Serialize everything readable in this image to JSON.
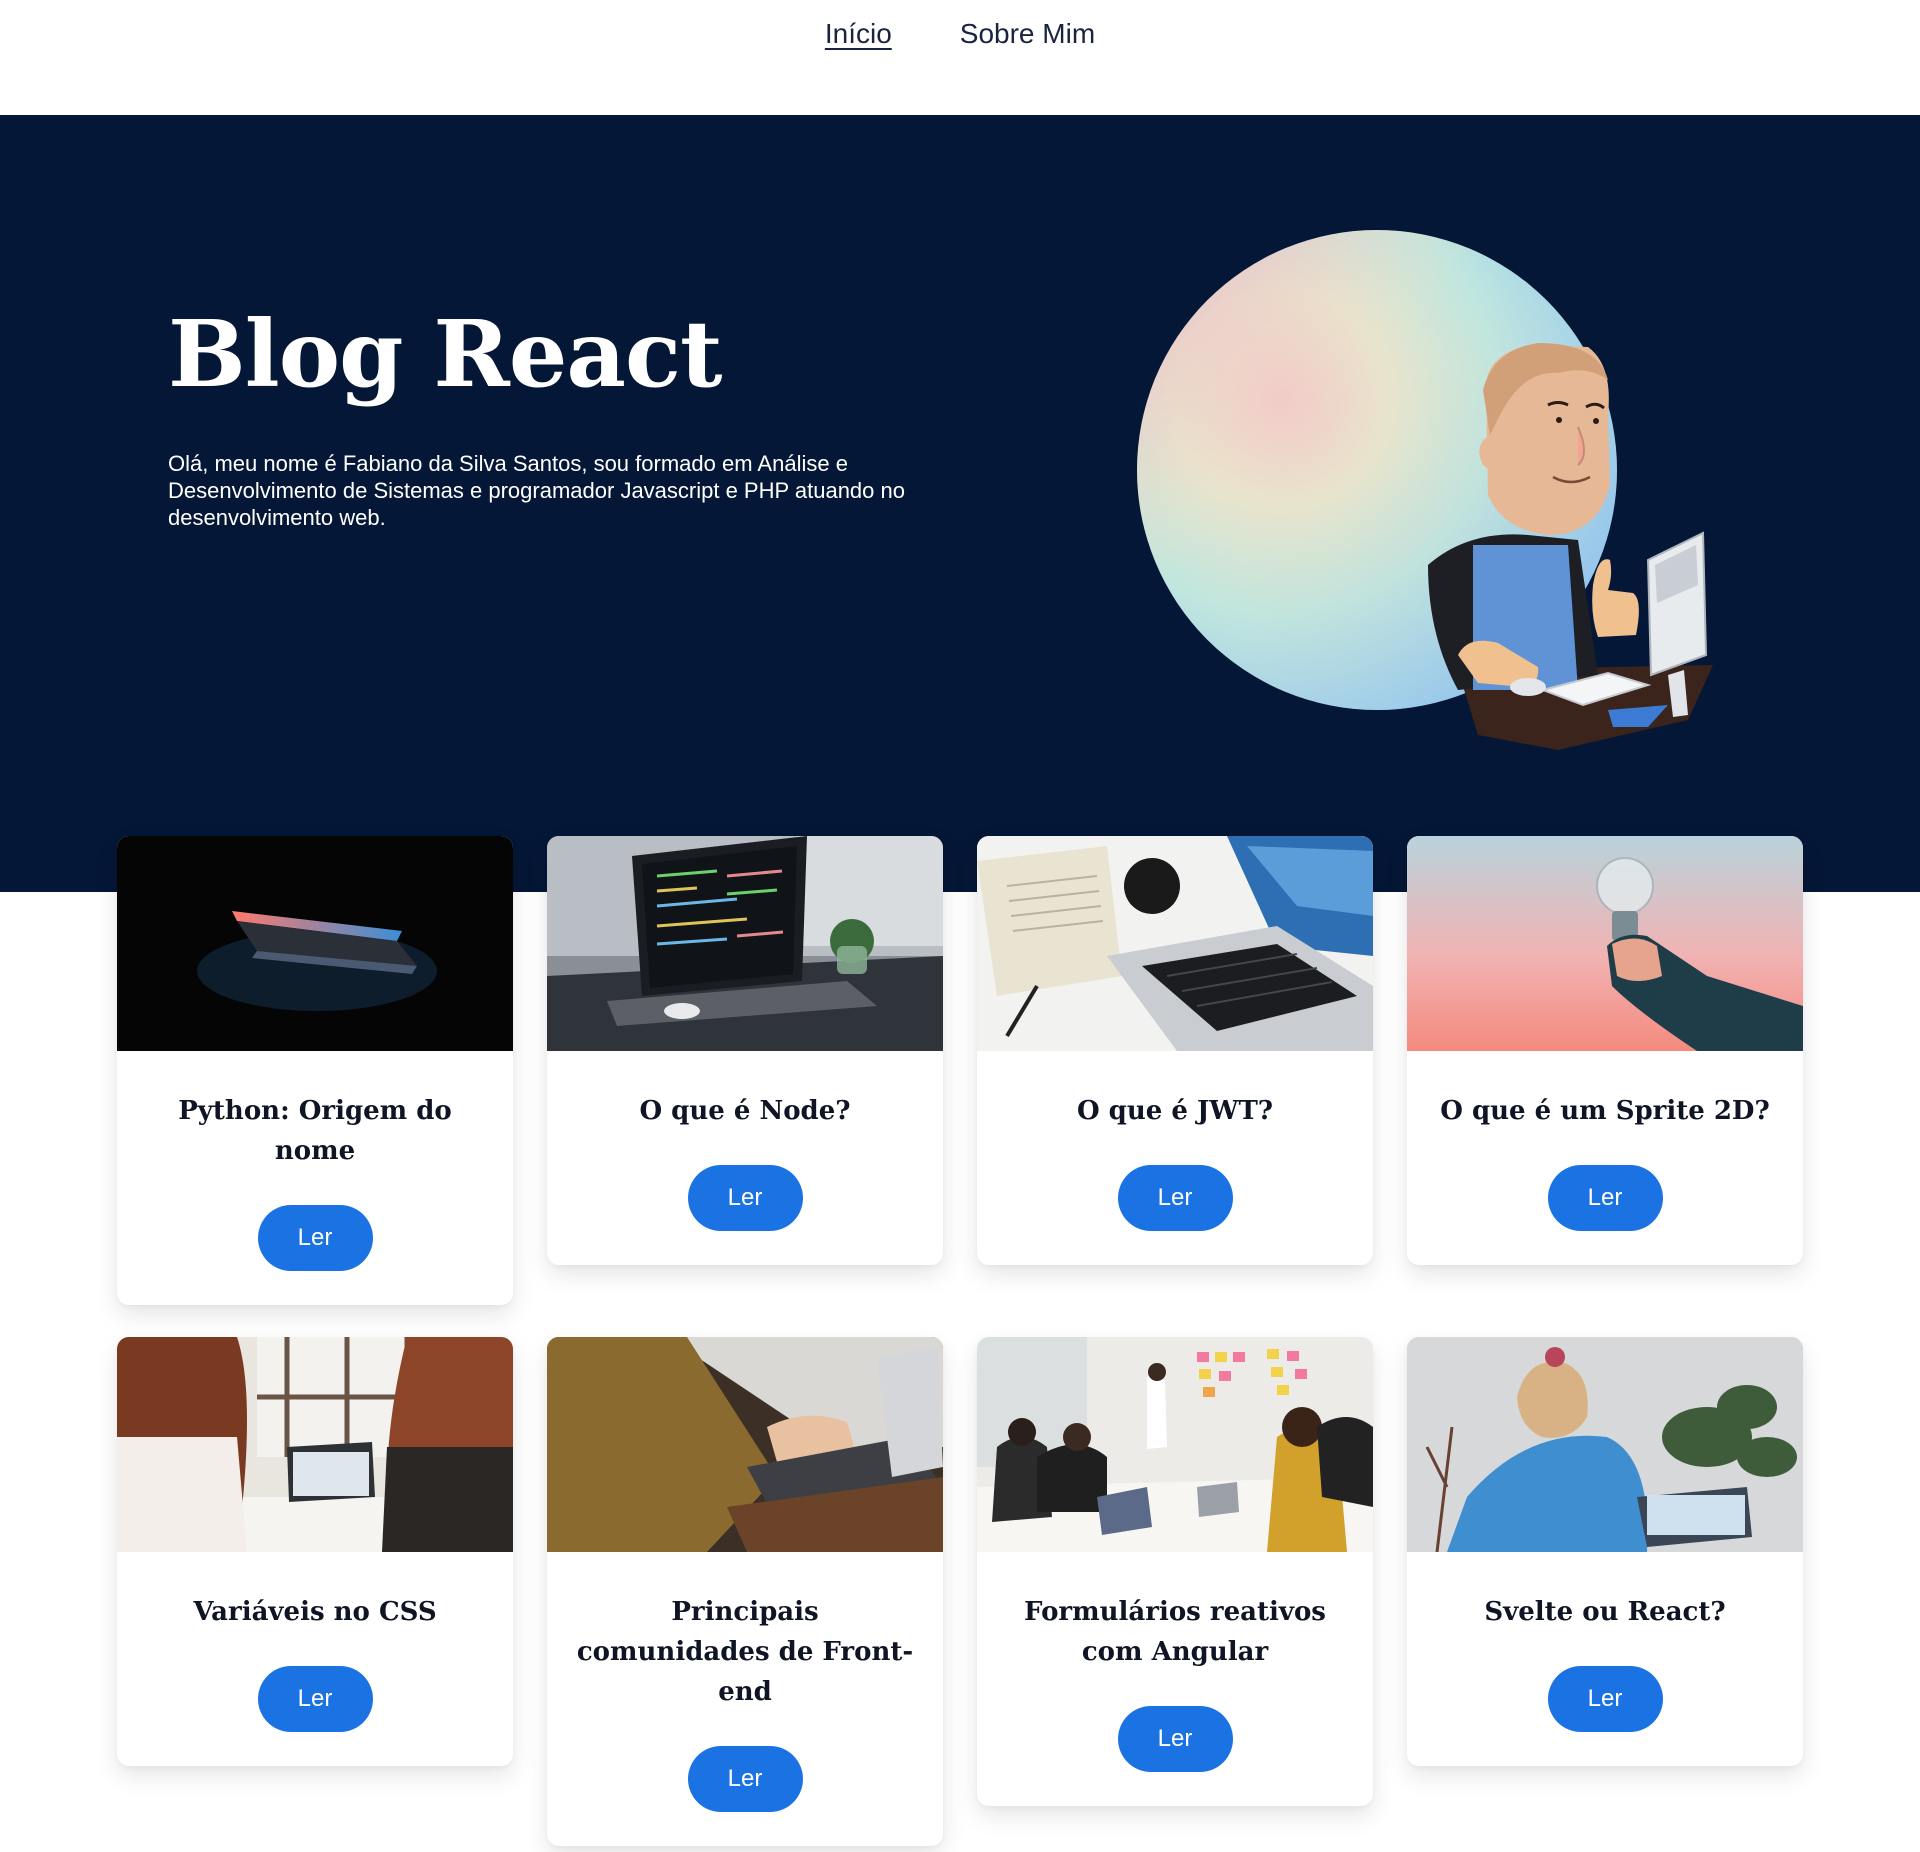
{
  "nav": {
    "items": [
      {
        "label": "Início",
        "active": true
      },
      {
        "label": "Sobre Mim",
        "active": false
      }
    ]
  },
  "hero": {
    "title": "Blog React",
    "description": "Olá, meu nome é Fabiano da Silva Santos, sou formado em Análise e Desenvolvimento de Sistemas e programador Javascript e PHP atuando no desenvolvimento web.",
    "background": "#051736"
  },
  "posts": [
    {
      "title": "Python: Origem do nome",
      "button": "Ler"
    },
    {
      "title": "O que é Node?",
      "button": "Ler"
    },
    {
      "title": "O que é JWT?",
      "button": "Ler"
    },
    {
      "title": "O que é um Sprite 2D?",
      "button": "Ler"
    },
    {
      "title": "Variáveis no CSS",
      "button": "Ler"
    },
    {
      "title": "Principais comunidades de Front-end",
      "button": "Ler"
    },
    {
      "title": "Formulários reativos com Angular",
      "button": "Ler"
    },
    {
      "title": "Svelte ou React?",
      "button": "Ler"
    }
  ],
  "colors": {
    "accent": "#1b73e3",
    "hero_bg": "#051736"
  }
}
